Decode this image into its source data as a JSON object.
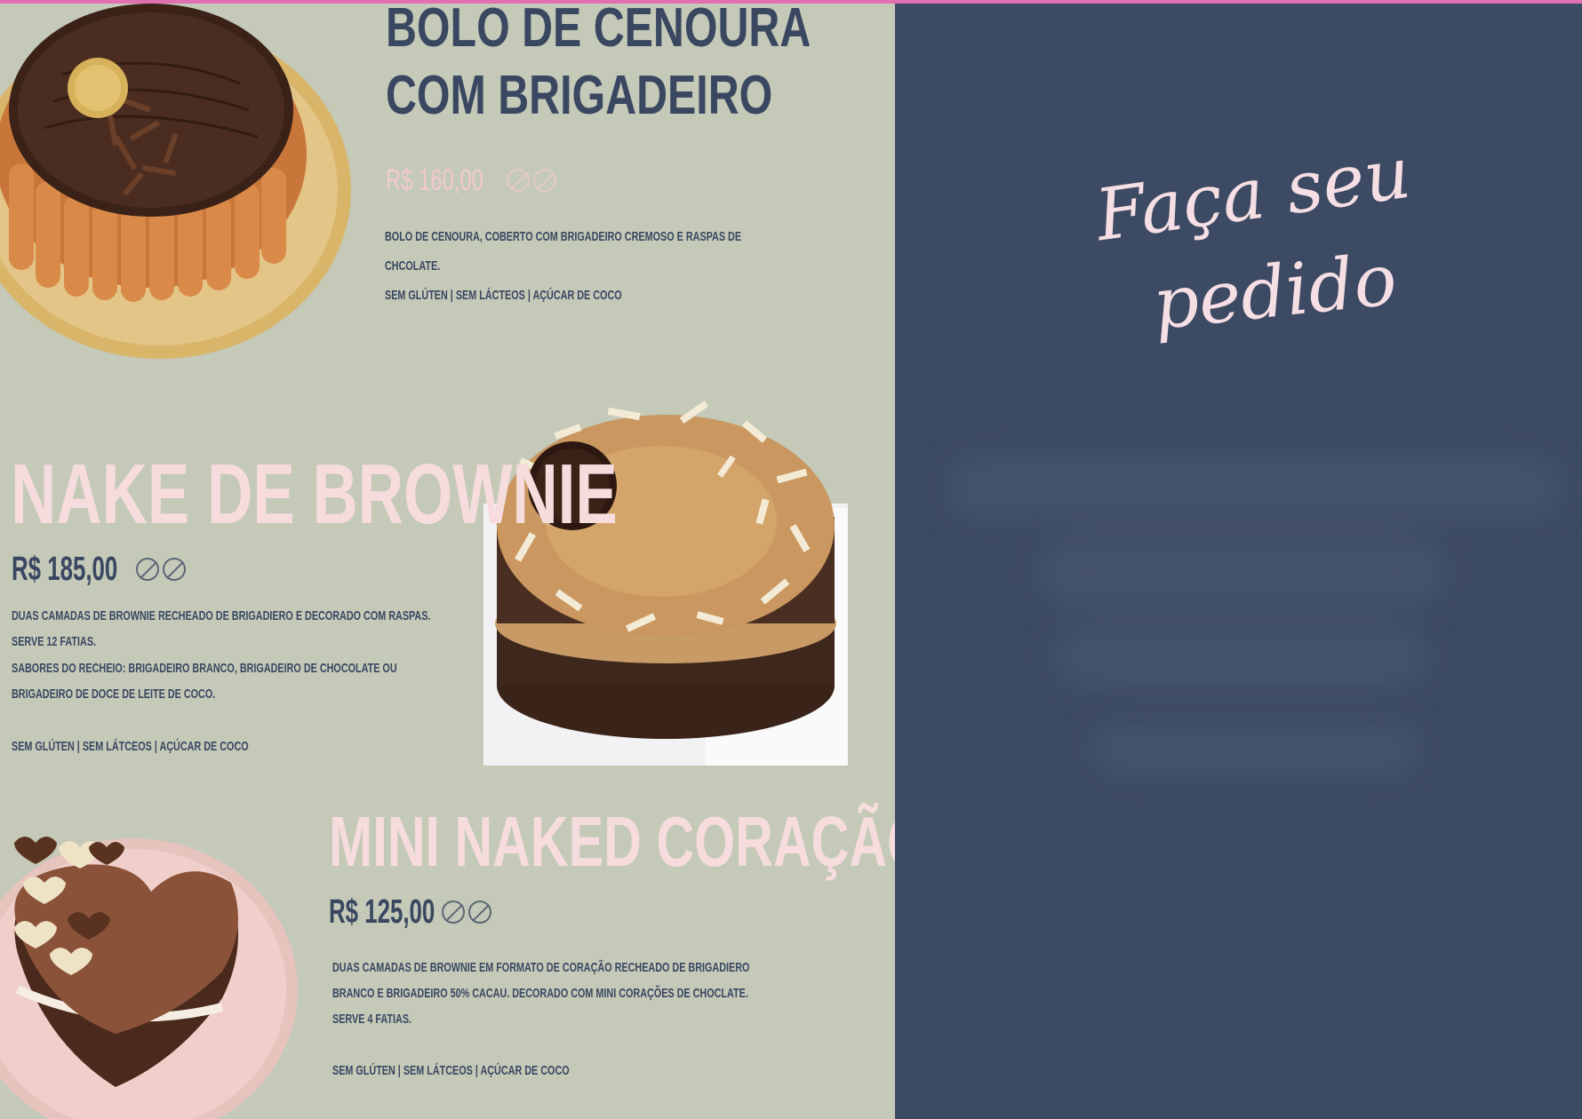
{
  "products": [
    {
      "title_line1": "BOLO DE CENOURA",
      "title_line2": "COM BRIGADEIRO",
      "price": "R$ 160,00",
      "desc_line1": "BOLO DE CENOURA, COBERTO COM BRIGADEIRO CREMOSO E RASPAS DE",
      "desc_line2": "CHCOLATE.",
      "tags": "SEM GLÚTEN | SEM LÁCTEOS | AÇÚCAR DE COCO",
      "icons": [
        "no-gluten-icon",
        "no-dairy-icon"
      ]
    },
    {
      "title": "NAKE DE BROWNIE",
      "price": "R$ 185,00",
      "desc_line1": "DUAS CAMADAS DE BROWNIE RECHEADO DE BRIGADIERO E DECORADO COM RASPAS.",
      "desc_line2": "SERVE 12 FATIAS.",
      "desc_line3": "SABORES DO RECHEIO: BRIGADEIRO BRANCO, BRIGADEIRO DE CHOCOLATE OU",
      "desc_line4": "BRIGADEIRO DE DOCE DE LEITE DE COCO.",
      "tags": "SEM GLÚTEN | SEM LÁTCEOS | AÇÚCAR DE COCO",
      "icons": [
        "no-dairy-icon",
        "no-gluten-icon"
      ]
    },
    {
      "title": "MINI NAKED CORAÇÃO",
      "price": "R$ 125,00",
      "desc_line1": "DUAS CAMADAS DE BROWNIE EM FORMATO DE CORAÇÃO  RECHEADO DE BRIGADIERO",
      "desc_line2": "BRANCO E BRIGADEIRO 50% CACAU. DECORADO COM MINI CORAÇÕES DE CHOCLATE.",
      "desc_line3": "SERVE 4 FATIAS.",
      "tags": "SEM GLÚTEN | SEM LÁTCEOS | AÇÚCAR DE COCO",
      "icons": [
        "no-gluten-icon",
        "no-dairy-icon"
      ]
    }
  ],
  "order_panel": {
    "script_line1": "Faça seu",
    "script_line2": "pedido"
  },
  "colors": {
    "background_sage": "#c4c9b8",
    "panel_navy": "#3d4a63",
    "text_navy": "#3a4761",
    "accent_pink": "#f6dcdc",
    "top_line": "#e070b0"
  }
}
